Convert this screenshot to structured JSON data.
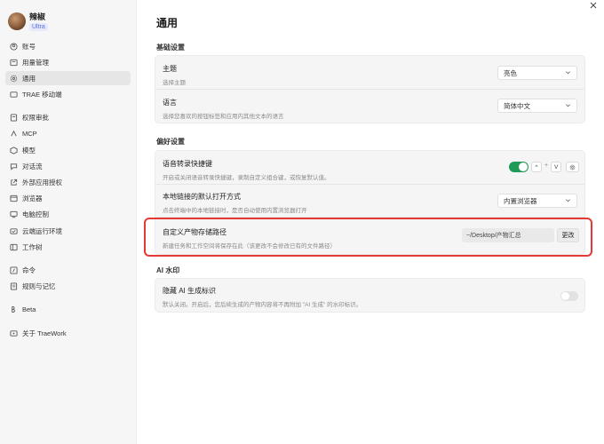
{
  "profile": {
    "name": "辣椒",
    "badge": "Ultra"
  },
  "sidebar": {
    "items": [
      {
        "label": "账号",
        "icon": "account-icon"
      },
      {
        "label": "用量管理",
        "icon": "usage-icon"
      },
      {
        "label": "通用",
        "icon": "settings-icon",
        "active": true
      },
      {
        "label": "TRAE 移动端",
        "icon": "mobile-icon"
      },
      {
        "label": "权限审批",
        "icon": "permission-icon"
      },
      {
        "label": "MCP",
        "icon": "mcp-icon"
      },
      {
        "label": "模型",
        "icon": "model-icon"
      },
      {
        "label": "对话流",
        "icon": "chat-flow-icon"
      },
      {
        "label": "外部应用授权",
        "icon": "external-app-icon"
      },
      {
        "label": "浏览器",
        "icon": "browser-icon"
      },
      {
        "label": "电脑控制",
        "icon": "computer-icon"
      },
      {
        "label": "云端运行环境",
        "icon": "cloud-icon"
      },
      {
        "label": "工作树",
        "icon": "worktree-icon"
      },
      {
        "label": "命令",
        "icon": "command-icon"
      },
      {
        "label": "规则与记忆",
        "icon": "rules-icon"
      },
      {
        "label": "Beta",
        "icon": "beta-icon"
      },
      {
        "label": "关于 TraeWork",
        "icon": "about-icon"
      }
    ]
  },
  "page": {
    "title": "通用"
  },
  "basic": {
    "section": "基础设置",
    "theme": {
      "title": "主题",
      "desc": "选择主题",
      "value": "亮色"
    },
    "language": {
      "title": "语言",
      "desc": "选择您喜欢的按钮标签和应用内其他文本的语言",
      "value": "简体中文"
    }
  },
  "prefs": {
    "section": "偏好设置",
    "voice": {
      "title": "语音转录快捷键",
      "desc": "开启或关闭语音转录快捷键，录制自定义组合键，或恢复默认值。",
      "enabled": true,
      "key1": "^",
      "plus": "+",
      "key2": "V"
    },
    "link": {
      "title": "本地链接的默认打开方式",
      "desc": "点击终端中的本地链接时，是否自动使用内置浏览器打开",
      "value": "内置浏览器"
    },
    "path": {
      "title": "自定义产物存储路径",
      "desc": "新建任务和工作空间将保存在此（该更改不会修改已有的文件路径）",
      "value": "~/Desktop/产物汇总",
      "button": "更改"
    }
  },
  "watermark": {
    "section": "AI 水印",
    "hide": {
      "title": "隐藏 AI 生成标识",
      "desc": "默认关闭。开启后，您后续生成的产物内容将不再附加 \"AI 生成\" 的水印标识。",
      "enabled": false
    }
  },
  "colors": {
    "accent_toggle": "#1f9a57",
    "highlight": "#e53935",
    "badge": "#5b6fd6"
  }
}
